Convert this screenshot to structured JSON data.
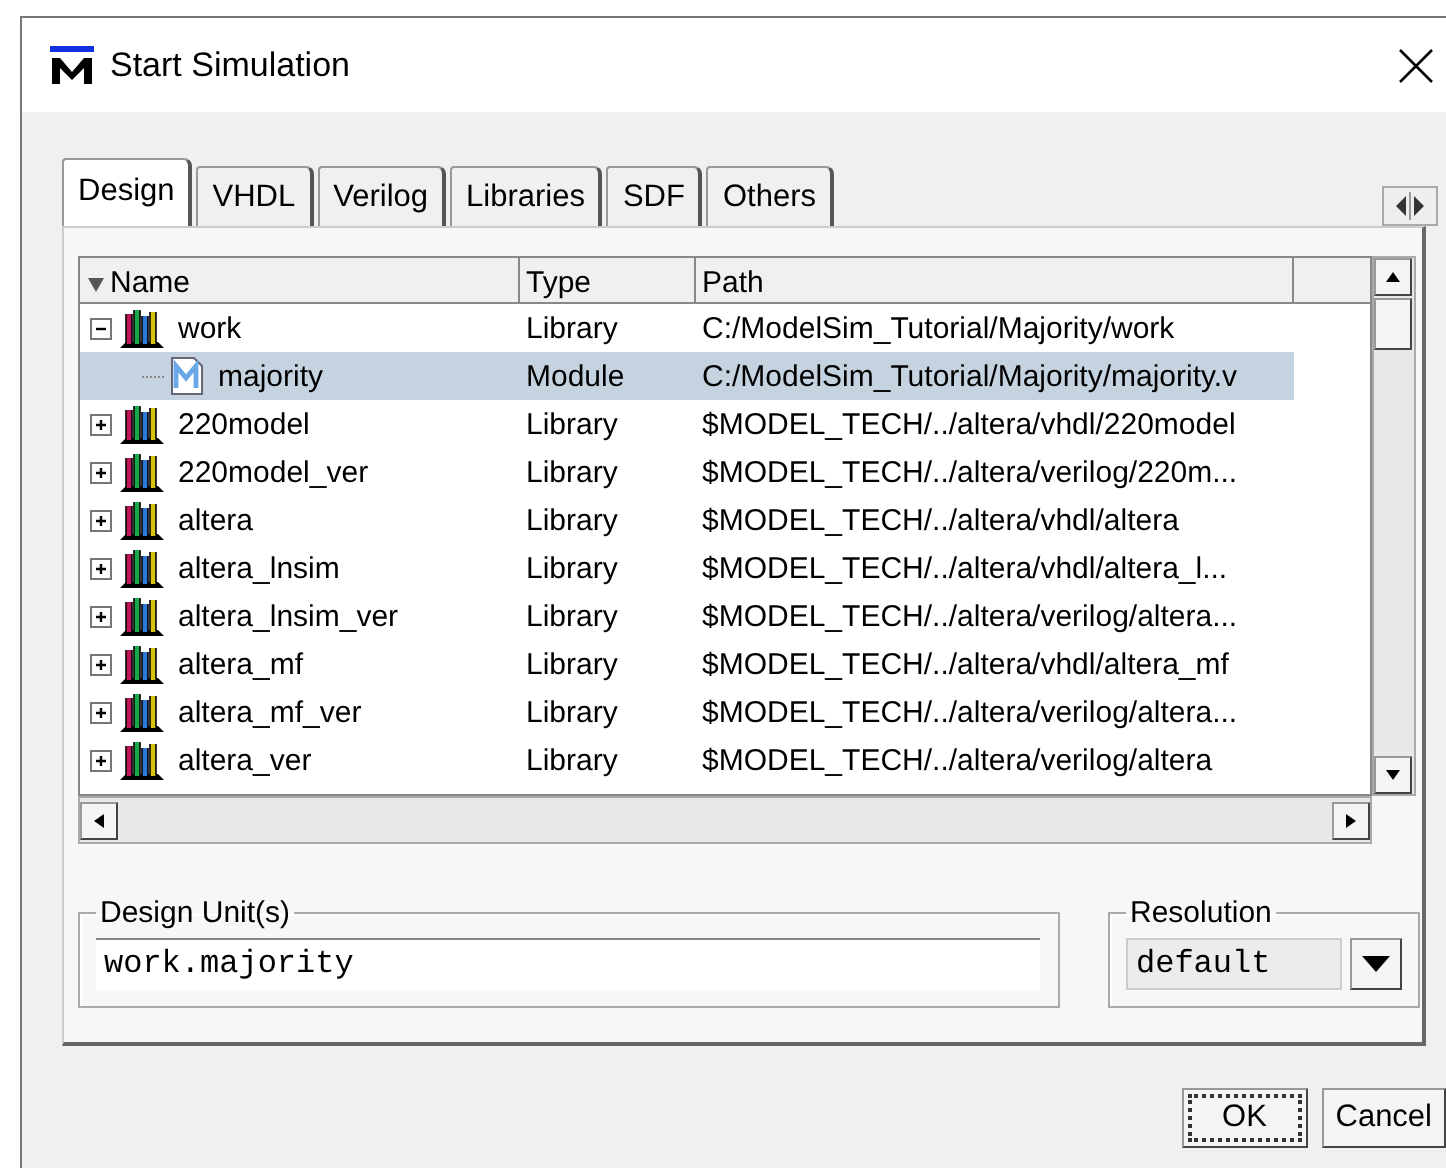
{
  "window": {
    "title": "Start Simulation"
  },
  "tabs": [
    {
      "label": "Design",
      "selected": true
    },
    {
      "label": "VHDL",
      "selected": false
    },
    {
      "label": "Verilog",
      "selected": false
    },
    {
      "label": "Libraries",
      "selected": false
    },
    {
      "label": "SDF",
      "selected": false
    },
    {
      "label": "Others",
      "selected": false
    }
  ],
  "table": {
    "columns": [
      "Name",
      "Type",
      "Path"
    ],
    "rows": [
      {
        "kind": "library",
        "name": "work",
        "type": "Library",
        "path": "C:/ModelSim_Tutorial/Majority/work",
        "expanded": true,
        "selected": false,
        "children": [
          {
            "kind": "module",
            "name": "majority",
            "type": "Module",
            "path": "C:/ModelSim_Tutorial/Majority/majority.v",
            "selected": true
          }
        ]
      },
      {
        "kind": "library",
        "name": "220model",
        "type": "Library",
        "path": "$MODEL_TECH/../altera/vhdl/220model",
        "expanded": false,
        "selected": false
      },
      {
        "kind": "library",
        "name": "220model_ver",
        "type": "Library",
        "path": "$MODEL_TECH/../altera/verilog/220m...",
        "expanded": false,
        "selected": false
      },
      {
        "kind": "library",
        "name": "altera",
        "type": "Library",
        "path": "$MODEL_TECH/../altera/vhdl/altera",
        "expanded": false,
        "selected": false
      },
      {
        "kind": "library",
        "name": "altera_lnsim",
        "type": "Library",
        "path": "$MODEL_TECH/../altera/vhdl/altera_l...",
        "expanded": false,
        "selected": false
      },
      {
        "kind": "library",
        "name": "altera_lnsim_ver",
        "type": "Library",
        "path": "$MODEL_TECH/../altera/verilog/altera...",
        "expanded": false,
        "selected": false
      },
      {
        "kind": "library",
        "name": "altera_mf",
        "type": "Library",
        "path": "$MODEL_TECH/../altera/vhdl/altera_mf",
        "expanded": false,
        "selected": false
      },
      {
        "kind": "library",
        "name": "altera_mf_ver",
        "type": "Library",
        "path": "$MODEL_TECH/../altera/verilog/altera...",
        "expanded": false,
        "selected": false
      },
      {
        "kind": "library",
        "name": "altera_ver",
        "type": "Library",
        "path": "$MODEL_TECH/../altera/verilog/altera",
        "expanded": false,
        "selected": false
      }
    ]
  },
  "design_units": {
    "label": "Design Unit(s)",
    "value": "work.majority"
  },
  "resolution": {
    "label": "Resolution",
    "value": "default"
  },
  "buttons": [
    "OK",
    "Cancel"
  ]
}
